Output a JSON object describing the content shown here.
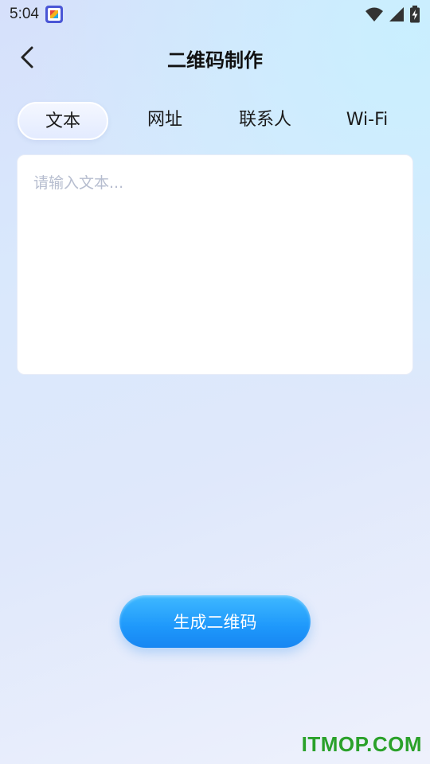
{
  "status_bar": {
    "time": "5:04",
    "icons": [
      "wifi-icon",
      "signal-icon",
      "battery-charging-icon"
    ]
  },
  "header": {
    "title": "二维码制作",
    "back_icon": "chevron-left-icon"
  },
  "tabs": [
    {
      "label": "文本",
      "active": true
    },
    {
      "label": "网址",
      "active": false
    },
    {
      "label": "联系人",
      "active": false
    },
    {
      "label": "Wi-Fi",
      "active": false
    }
  ],
  "input": {
    "value": "",
    "placeholder": "请输入文本..."
  },
  "actions": {
    "generate_label": "生成二维码"
  },
  "watermark": "ITMOP.COM",
  "colors": {
    "accent": "#1e98fb",
    "watermark": "#2aa12a",
    "placeholder": "#b6bdcf"
  }
}
